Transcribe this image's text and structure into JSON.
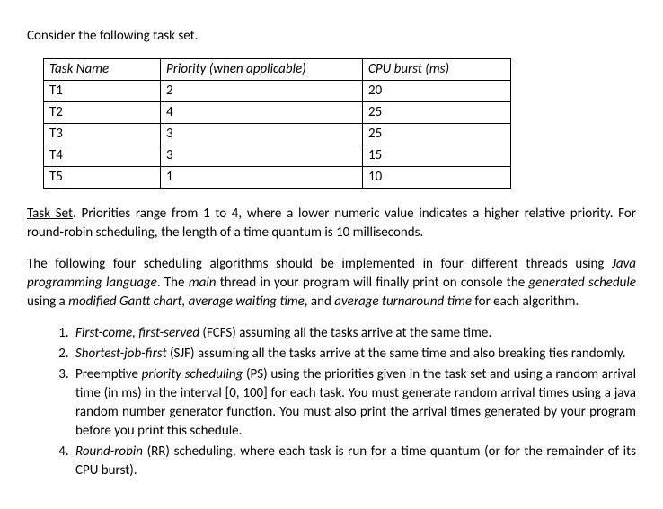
{
  "intro": "Consider the following task set.",
  "table": {
    "headers": {
      "name": "Task Name",
      "priority": "Priority (when applicable)",
      "burst": "CPU burst (ms)"
    },
    "rows": [
      {
        "name": "T1",
        "priority": "2",
        "burst": "20"
      },
      {
        "name": "T2",
        "priority": "4",
        "burst": "25"
      },
      {
        "name": "T3",
        "priority": "3",
        "burst": "25"
      },
      {
        "name": "T4",
        "priority": "3",
        "burst": "15"
      },
      {
        "name": "T5",
        "priority": "1",
        "burst": "10"
      }
    ]
  },
  "taskset_label": "Task Set",
  "taskset_text": ". Priorities range from 1 to 4, where a lower numeric value indicates a higher relative priority. For round-robin scheduling, the length of a time quantum is 10 milliseconds.",
  "impl": {
    "part1": "The following four scheduling algorithms should be implemented in four different threads using ",
    "java": "Java programming language",
    "part2": ". The ",
    "main": "main",
    "part3": " thread in your program will finally print on console the ",
    "gensched": "generated schedule",
    "part4": " using a ",
    "gantt": "modified Gantt chart, average waiting time",
    "part5": ", and ",
    "turnaround": "average turnaround time",
    "part6": " for each algorithm."
  },
  "list": {
    "i1": {
      "alg": "First-come, first-served",
      "rest": " (FCFS) assuming all the tasks arrive at the same time."
    },
    "i2": {
      "alg": "Shortest-job-first",
      "rest": " (SJF) assuming all the tasks arrive at the same time and also breaking ties randomly."
    },
    "i3": {
      "pre": "Preemptive ",
      "alg": "priority scheduling",
      "rest": " (PS) using the priorities given in the task set and using a random arrival time (in ms) in the interval [0, 100] for each task. You must generate random arrival times using a java random number generator function. You must also print the arrival times generated by your program before you print this schedule."
    },
    "i4": {
      "alg": "Round-robin",
      "rest": " (RR) scheduling, where each task is run for a time quantum (or for the remainder of its CPU burst)."
    }
  },
  "chart_data": {
    "type": "table",
    "title": "Task Set",
    "columns": [
      "Task Name",
      "Priority (when applicable)",
      "CPU burst (ms)"
    ],
    "data": [
      [
        "T1",
        2,
        20
      ],
      [
        "T2",
        4,
        25
      ],
      [
        "T3",
        3,
        25
      ],
      [
        "T4",
        3,
        15
      ],
      [
        "T5",
        1,
        10
      ]
    ]
  }
}
